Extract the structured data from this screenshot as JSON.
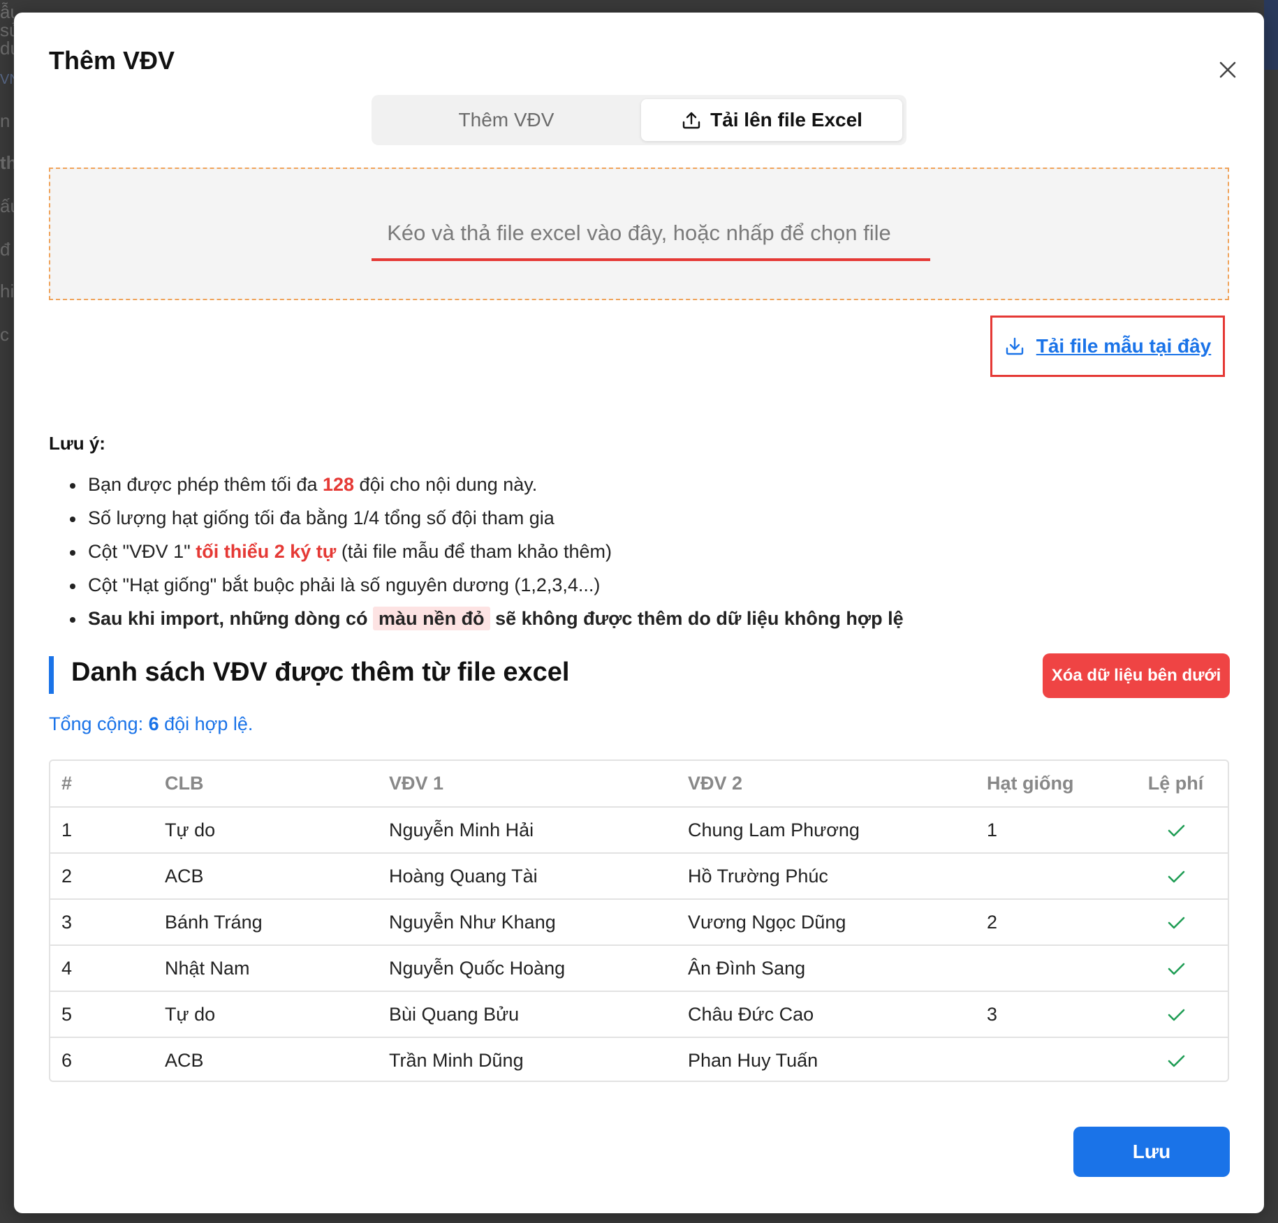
{
  "background": {
    "left_fragments": [
      "ẫu sử dụng",
      "VN",
      "n",
      "th",
      "ấu",
      "đ",
      "hi",
      "c"
    ]
  },
  "modal": {
    "title": "Thêm VĐV",
    "close_icon": "close-icon"
  },
  "tabs": [
    {
      "label": "Thêm VĐV",
      "active": false
    },
    {
      "label": "Tải lên file Excel",
      "active": true,
      "icon": "upload-icon"
    }
  ],
  "dropzone": {
    "text": "Kéo và thả file excel vào đây, hoặc nhấp để chọn file"
  },
  "template_link": {
    "label": "Tải file mẫu tại đây",
    "icon": "download-icon"
  },
  "notes": {
    "title": "Lưu ý:",
    "items": {
      "n1_a": "Bạn được phép thêm tối đa ",
      "n1_b": "128",
      "n1_c": " đội cho nội dung này.",
      "n2": "Số lượng hạt giống tối đa bằng 1/4 tổng số đội tham gia",
      "n3_a": "Cột \"VĐV 1\" ",
      "n3_b": "tối thiểu 2 ký tự",
      "n3_c": " (tải file mẫu để tham khảo thêm)",
      "n4": "Cột \"Hạt giống\" bắt buộc phải là số nguyên dương (1,2,3,4...)",
      "n5_a": "Sau khi import, những dòng có ",
      "n5_b": "màu nền đỏ",
      "n5_c": " sẽ không được thêm do dữ liệu không hợp lệ"
    }
  },
  "section": {
    "title": "Danh sách VĐV được thêm từ file excel",
    "clear_button": "Xóa dữ liệu bên dưới",
    "total_prefix": "Tổng cộng: ",
    "total_count": "6",
    "total_suffix": " đội hợp lệ."
  },
  "table": {
    "headers": [
      "#",
      "CLB",
      "VĐV 1",
      "VĐV 2",
      "Hạt giống",
      "Lệ phí"
    ],
    "rows": [
      [
        "1",
        "Tự do",
        "Nguyễn Minh Hải",
        "Chung Lam Phương",
        "1"
      ],
      [
        "2",
        "ACB",
        "Hoàng Quang Tài",
        "Hồ Trường Phúc",
        ""
      ],
      [
        "3",
        "Bánh Tráng",
        "Nguyễn Như Khang",
        "Vương Ngọc Dũng",
        "2"
      ],
      [
        "4",
        "Nhật Nam",
        "Nguyễn Quốc Hoàng",
        "Ân Đình Sang",
        ""
      ],
      [
        "5",
        "Tự do",
        "Bùi Quang Bửu",
        "Châu Đức Cao",
        "3"
      ],
      [
        "6",
        "ACB",
        "Trần Minh Dũng",
        "Phan Huy Tuấn",
        ""
      ]
    ],
    "fee_icon": "check-icon"
  },
  "footer": {
    "save_label": "Lưu"
  },
  "colors": {
    "primary": "#1a73e8",
    "danger": "#ef4444",
    "check": "#1f9d55",
    "dropzone_border": "#f0a35a"
  }
}
